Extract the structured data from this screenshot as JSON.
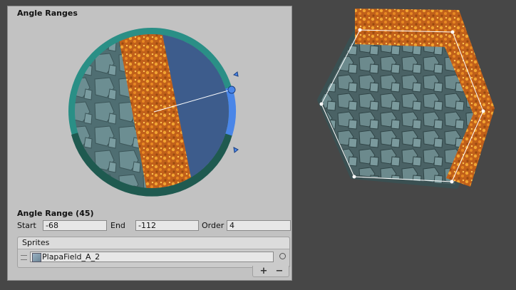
{
  "inspector": {
    "title": "Angle Ranges",
    "range_title": "Angle Range (45)",
    "fields": {
      "start_label": "Start",
      "start_value": "-68",
      "end_label": "End",
      "end_value": "-112",
      "order_label": "Order",
      "order_value": "4"
    },
    "sprites": {
      "header": "Sprites",
      "items": [
        {
          "name": "PlapaField_A_2"
        }
      ],
      "add_label": "+",
      "remove_label": "−"
    }
  },
  "colors": {
    "panel_bg": "#c2c2c2",
    "scene_bg": "#474747",
    "ring_teal": "#2a8f86",
    "ring_dark": "#1f5a50",
    "range_selected": "#4a86e8",
    "preview_sky": "#3d5c8c",
    "rock": "#5b7c80",
    "grass_orange": "#d9731a"
  },
  "icons": [
    "angle-handle-icon",
    "sprite-icon",
    "object-picker-icon",
    "drag-handle-icon"
  ]
}
